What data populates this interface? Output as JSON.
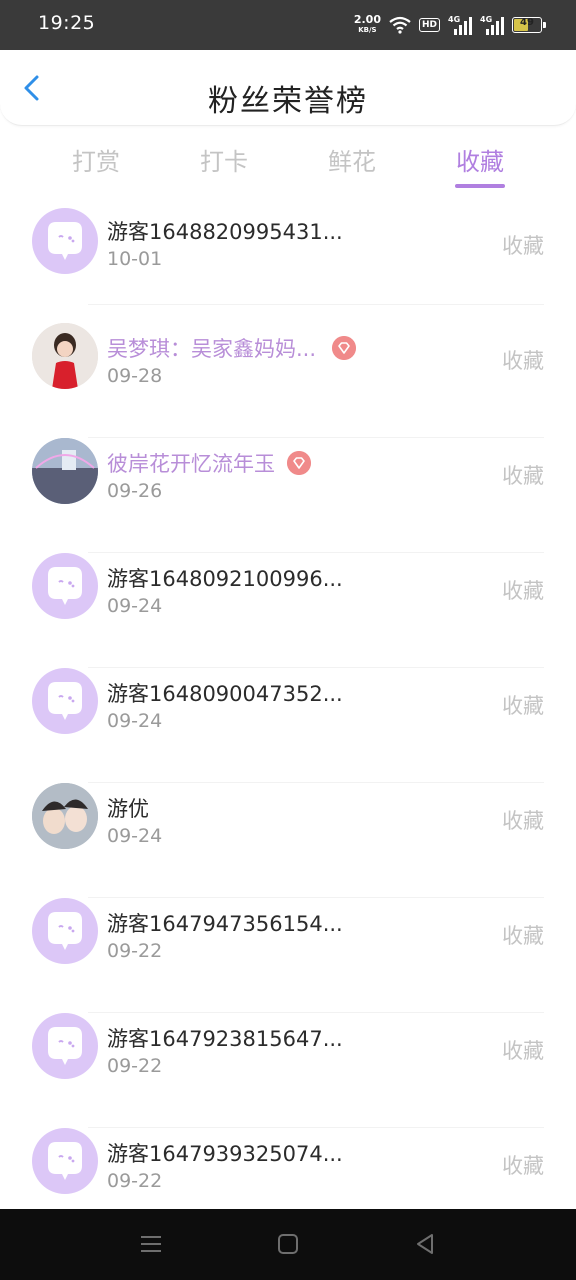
{
  "status_bar": {
    "time": "19:25",
    "net_speed": "2.00",
    "net_unit": "KB/S",
    "hd": "HD",
    "sig1": "4G",
    "sig2": "4G",
    "battery": "49"
  },
  "header": {
    "title": "粉丝荣誉榜"
  },
  "tabs": [
    {
      "label": "打赏"
    },
    {
      "label": "打卡"
    },
    {
      "label": "鲜花"
    },
    {
      "label": "收藏"
    }
  ],
  "active_tab": "收藏",
  "colors": {
    "accent": "#b07fe0",
    "vip_name": "#b88ed8",
    "vip_badge": "#f08a8a",
    "avatar_default": "#dcc7f7"
  },
  "rows": [
    {
      "name": "游客1648820995431...",
      "date": "10-01",
      "action": "收藏",
      "avatar": "chat-bubble-icon",
      "vip": false
    },
    {
      "name": "吴梦琪：吴家鑫妈妈...",
      "date": "09-28",
      "action": "收藏",
      "avatar": "user-photo",
      "vip": true
    },
    {
      "name": "彼岸花开忆流年玉",
      "date": "09-26",
      "action": "收藏",
      "avatar": "user-photo",
      "vip": true
    },
    {
      "name": "游客1648092100996...",
      "date": "09-24",
      "action": "收藏",
      "avatar": "chat-bubble-icon",
      "vip": false
    },
    {
      "name": "游客1648090047352...",
      "date": "09-24",
      "action": "收藏",
      "avatar": "chat-bubble-icon",
      "vip": false
    },
    {
      "name": "游优",
      "date": "09-24",
      "action": "收藏",
      "avatar": "user-photo",
      "vip": false
    },
    {
      "name": "游客1647947356154...",
      "date": "09-22",
      "action": "收藏",
      "avatar": "chat-bubble-icon",
      "vip": false
    },
    {
      "name": "游客1647923815647...",
      "date": "09-22",
      "action": "收藏",
      "avatar": "chat-bubble-icon",
      "vip": false
    },
    {
      "name": "游客1647939325074...",
      "date": "09-22",
      "action": "收藏",
      "avatar": "chat-bubble-icon",
      "vip": false
    }
  ]
}
